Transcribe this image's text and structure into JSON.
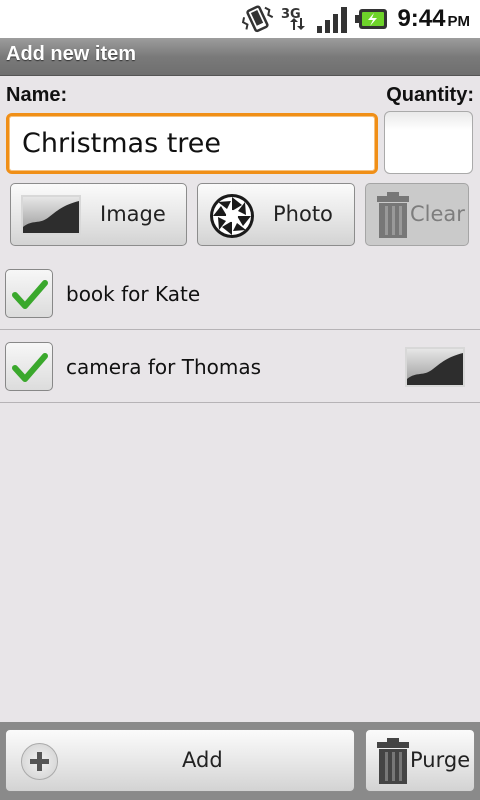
{
  "status_bar": {
    "time": "9:44",
    "ampm": "PM",
    "icons": [
      "vibrate-icon",
      "3g-data-icon",
      "signal-icon",
      "battery-charging-icon"
    ]
  },
  "title_bar": {
    "title": "Add new item"
  },
  "form": {
    "name_label": "Name:",
    "quantity_label": "Quantity:",
    "name_value": "Christmas tree",
    "quantity_value": ""
  },
  "buttons": {
    "image_label": "Image",
    "photo_label": "Photo",
    "clear_label": "Clear",
    "add_label": "Add",
    "purge_label": "Purge"
  },
  "list": {
    "items": [
      {
        "text": "book for Kate",
        "checked": true,
        "has_image": false
      },
      {
        "text": "camera for Thomas",
        "checked": true,
        "has_image": true
      }
    ]
  },
  "colors": {
    "focus_border": "#f08f17",
    "check_green": "#3aa82c",
    "title_bar": "#7a7a7a"
  }
}
